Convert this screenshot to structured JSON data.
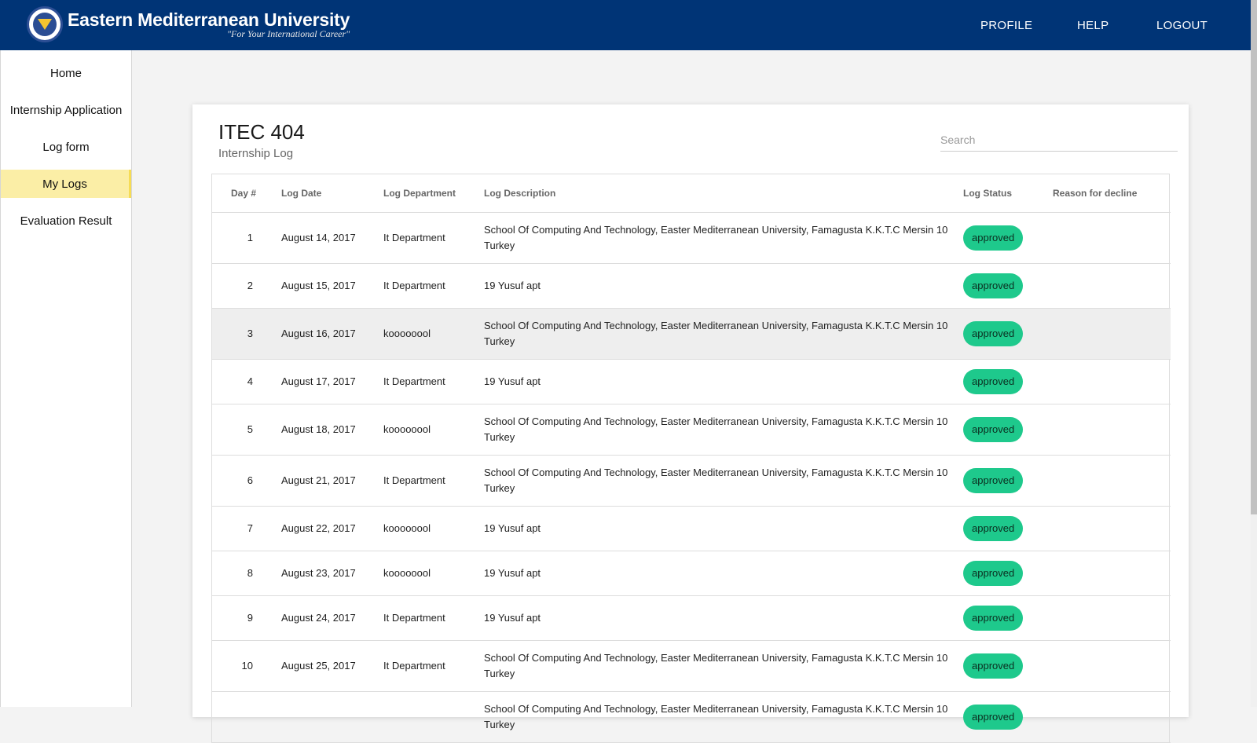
{
  "header": {
    "brand_name": "Eastern Mediterranean University",
    "tagline": "\"For Your International Career\"",
    "nav": [
      "PROFILE",
      "HELP",
      "LOGOUT"
    ],
    "bg_color": "#003476"
  },
  "sidebar": {
    "items": [
      {
        "label": "Home",
        "active": false
      },
      {
        "label": "Internship Application",
        "active": false
      },
      {
        "label": "Log form",
        "active": false
      },
      {
        "label": "My Logs",
        "active": true
      },
      {
        "label": "Evaluation Result",
        "active": false
      }
    ],
    "active_color": "#fbeea6"
  },
  "main": {
    "title": "ITEC 404",
    "subtitle": "Internship Log",
    "search_placeholder": "Search",
    "columns": [
      "Day #",
      "Log Date",
      "Log Department",
      "Log Description",
      "Log Status",
      "Reason for decline"
    ],
    "rows": [
      {
        "day": "1",
        "date": "August 14, 2017",
        "department": "It Department",
        "description": "School Of Computing And Technology, Easter Mediterranean University, Famagusta K.K.T.C Mersin 10 Turkey",
        "status": "approved",
        "reason": ""
      },
      {
        "day": "2",
        "date": "August 15, 2017",
        "department": "It Department",
        "description": "19 Yusuf apt",
        "status": "approved",
        "reason": ""
      },
      {
        "day": "3",
        "date": "August 16, 2017",
        "department": "koooooool",
        "description": "School Of Computing And Technology, Easter Mediterranean University, Famagusta K.K.T.C Mersin 10 Turkey",
        "status": "approved",
        "reason": ""
      },
      {
        "day": "4",
        "date": "August 17, 2017",
        "department": "It Department",
        "description": "19 Yusuf apt",
        "status": "approved",
        "reason": ""
      },
      {
        "day": "5",
        "date": "August 18, 2017",
        "department": "koooooool",
        "description": "School Of Computing And Technology, Easter Mediterranean University, Famagusta K.K.T.C Mersin 10 Turkey",
        "status": "approved",
        "reason": ""
      },
      {
        "day": "6",
        "date": "August 21, 2017",
        "department": "It Department",
        "description": "School Of Computing And Technology, Easter Mediterranean University, Famagusta K.K.T.C Mersin 10 Turkey",
        "status": "approved",
        "reason": ""
      },
      {
        "day": "7",
        "date": "August 22, 2017",
        "department": "koooooool",
        "description": "19 Yusuf apt",
        "status": "approved",
        "reason": ""
      },
      {
        "day": "8",
        "date": "August 23, 2017",
        "department": "koooooool",
        "description": "19 Yusuf apt",
        "status": "approved",
        "reason": ""
      },
      {
        "day": "9",
        "date": "August 24, 2017",
        "department": "It Department",
        "description": "19 Yusuf apt",
        "status": "approved",
        "reason": ""
      },
      {
        "day": "10",
        "date": "August 25, 2017",
        "department": "It Department",
        "description": "School Of Computing And Technology, Easter Mediterranean University, Famagusta K.K.T.C Mersin 10 Turkey",
        "status": "approved",
        "reason": ""
      },
      {
        "day": "",
        "date": "",
        "department": "",
        "description": "School Of Computing And Technology, Easter Mediterranean University, Famagusta K.K.T.C Mersin 10 Turkey",
        "status": "approved",
        "reason": ""
      }
    ],
    "status_color": "#1ec98c",
    "highlighted_row": 3
  }
}
